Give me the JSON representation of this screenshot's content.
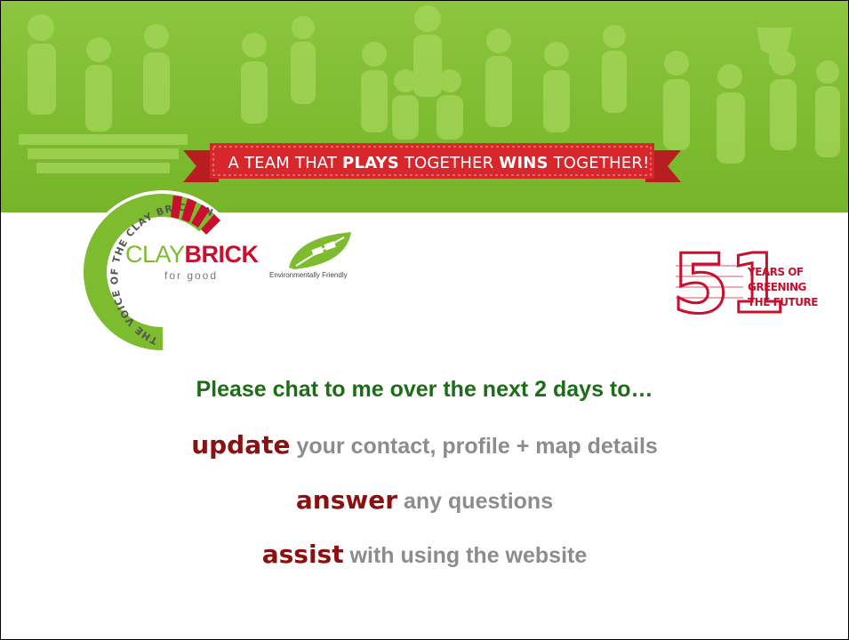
{
  "banner": {
    "tagline_1": "A TEAM THAT ",
    "tagline_2": "PLAYS",
    "tagline_3": " TOGETHER ",
    "tagline_4": "WINS",
    "tagline_5": " TOGETHER!"
  },
  "logo": {
    "clay": "CLAY",
    "brick": "BRICK",
    "subtitle": "for good",
    "ring_text": "THE VOICE OF THE CLAY BRICK INDUSTRY"
  },
  "eco": {
    "label": "Environmentally Friendly"
  },
  "anniversary": {
    "number": "51",
    "line1": "YEARS OF",
    "line2": "GREENING",
    "line3": "THE FUTURE"
  },
  "content": {
    "headline": "Please chat to me over the next 2 days to…",
    "items": [
      {
        "keyword": "update",
        "text": " your contact, profile + map details"
      },
      {
        "keyword": "answer",
        "text": " any questions"
      },
      {
        "keyword": "assist",
        "text": " with using the website"
      }
    ]
  },
  "colors": {
    "banner_green": "#7dbb2f",
    "ribbon_red": "#d7262c",
    "headline_green": "#1b6d16",
    "keyword_red": "#8b1010",
    "body_gray": "#8c8c8c"
  }
}
